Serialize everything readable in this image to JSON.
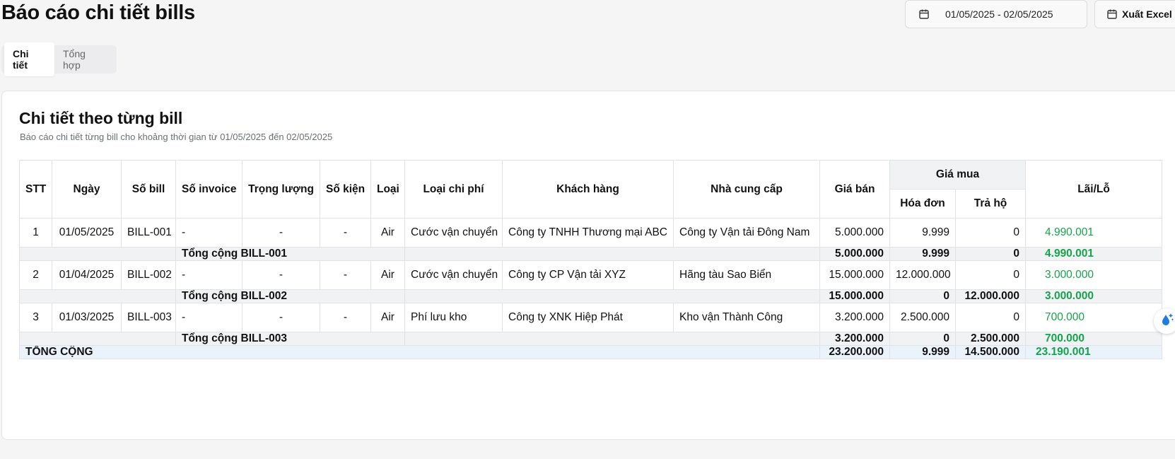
{
  "header": {
    "title": "Báo cáo chi tiết bills",
    "date_range": "01/05/2025 - 02/05/2025",
    "export_label": "Xuất Excel"
  },
  "tabs": [
    {
      "label": "Chi tiết",
      "active": true
    },
    {
      "label": "Tổng hợp",
      "active": false
    }
  ],
  "card": {
    "title": "Chi tiết theo từng bill",
    "description": "Báo cáo chi tiết từng bill cho khoảng thời gian từ 01/05/2025 đến 02/05/2025"
  },
  "table": {
    "headers": {
      "stt": "STT",
      "ngay": "Ngày",
      "so_bill": "Số bill",
      "so_invoice": "Số invoice",
      "trong_luong": "Trọng lượng",
      "so_kien": "Số kiện",
      "loai": "Loại",
      "loai_chi_phi": "Loại chi phí",
      "khach_hang": "Khách hàng",
      "nha_cung_cap": "Nhà cung cấp",
      "gia_ban": "Giá bán",
      "gia_mua": "Giá mua",
      "hoa_don": "Hóa đơn",
      "tra_ho": "Trả hộ",
      "lai_lo": "Lãi/Lỗ"
    },
    "bills": [
      {
        "stt": "1",
        "ngay": "01/05/2025",
        "so_bill": "BILL-001",
        "so_invoice": "-",
        "trong_luong": "-",
        "so_kien": "-",
        "loai": "Air",
        "loai_chi_phi": "Cước vận chuyển",
        "khach_hang": "Công ty TNHH Thương mại ABC",
        "nha_cung_cap": "Công ty Vận tải Đông Nam",
        "gia_ban": "5.000.000",
        "hoa_don": "9.999",
        "tra_ho": "0",
        "lai_lo": "4.990.001",
        "subtotal": {
          "label": "Tổng cộng BILL-001",
          "gia_ban": "5.000.000",
          "hoa_don": "9.999",
          "tra_ho": "0",
          "lai_lo": "4.990.001"
        }
      },
      {
        "stt": "2",
        "ngay": "01/04/2025",
        "so_bill": "BILL-002",
        "so_invoice": "-",
        "trong_luong": "-",
        "so_kien": "-",
        "loai": "Air",
        "loai_chi_phi": "Cước vận chuyển",
        "khach_hang": "Công ty CP Vận tải XYZ",
        "nha_cung_cap": "Hãng tàu Sao Biển",
        "gia_ban": "15.000.000",
        "hoa_don": "12.000.000",
        "tra_ho": "0",
        "lai_lo": "3.000.000",
        "subtotal": {
          "label": "Tổng cộng BILL-002",
          "gia_ban": "15.000.000",
          "hoa_don": "0",
          "tra_ho": "12.000.000",
          "lai_lo": "3.000.000"
        }
      },
      {
        "stt": "3",
        "ngay": "01/03/2025",
        "so_bill": "BILL-003",
        "so_invoice": "-",
        "trong_luong": "-",
        "so_kien": "-",
        "loai": "Air",
        "loai_chi_phi": "Phí lưu kho",
        "khach_hang": "Công ty XNK Hiệp Phát",
        "nha_cung_cap": "Kho vận Thành Công",
        "gia_ban": "3.200.000",
        "hoa_don": "2.500.000",
        "tra_ho": "0",
        "lai_lo": "700.000",
        "subtotal": {
          "label": "Tổng cộng BILL-003",
          "gia_ban": "3.200.000",
          "hoa_don": "0",
          "tra_ho": "2.500.000",
          "lai_lo": "700.000"
        }
      }
    ],
    "grand_total": {
      "label": "TỔNG CỘNG",
      "gia_ban": "23.200.000",
      "hoa_don": "9.999",
      "tra_ho": "14.500.000",
      "lai_lo": "23.190.001"
    }
  },
  "colors": {
    "profit": "#17a34a",
    "subtotal_bg": "#f1f2f4",
    "total_bg": "#eaf2fb"
  },
  "icons": {
    "date_range": "calendar-icon",
    "export": "calendar-icon",
    "floating": "water-drop-sparkle-icon"
  }
}
